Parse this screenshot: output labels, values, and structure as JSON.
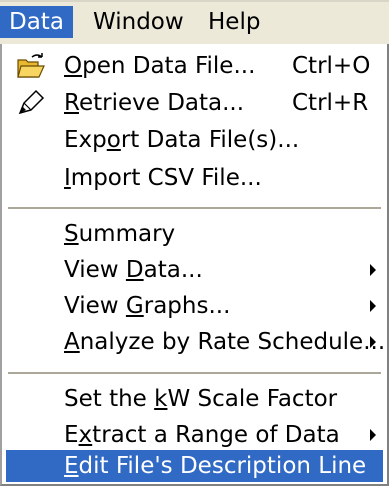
{
  "menubar": {
    "items": [
      {
        "label": "Data"
      },
      {
        "label": "Window"
      },
      {
        "label": "Help"
      }
    ]
  },
  "menu": {
    "items": [
      {
        "pre": "",
        "u": "O",
        "post": "pen Data File...",
        "shortcut": "Ctrl+O",
        "icon": "open-folder-icon"
      },
      {
        "pre": "",
        "u": "R",
        "post": "etrieve Data...",
        "shortcut": "Ctrl+R",
        "icon": "retrieve-pen-icon"
      },
      {
        "pre": "Exp",
        "u": "o",
        "post": "rt Data File(s)..."
      },
      {
        "pre": "",
        "u": "I",
        "post": "mport CSV File..."
      },
      {
        "pre": "",
        "u": "S",
        "post": "ummary"
      },
      {
        "pre": "View ",
        "u": "D",
        "post": "ata..."
      },
      {
        "pre": "View ",
        "u": "G",
        "post": "raphs..."
      },
      {
        "pre": "",
        "u": "A",
        "post": "nalyze by Rate Schedule..."
      },
      {
        "pre": "Set the ",
        "u": "k",
        "post": "W Scale Factor"
      },
      {
        "pre": "E",
        "u": "x",
        "post": "tract a Range of Data"
      },
      {
        "pre": "",
        "u": "E",
        "post": "dit File's Description Line"
      }
    ]
  },
  "colors": {
    "highlight": "#316ac5",
    "menubar_bg": "#ece9d8"
  }
}
